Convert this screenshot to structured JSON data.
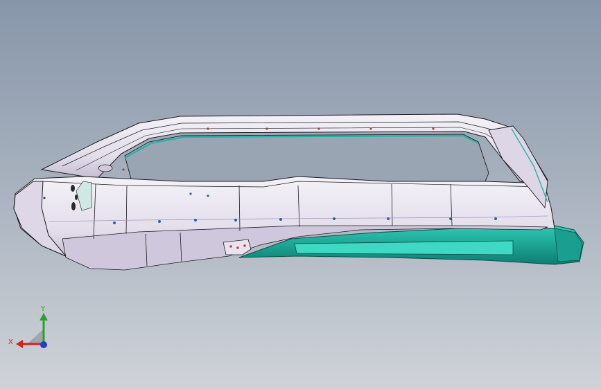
{
  "viewport": {
    "background_top": "#8796aa",
    "background_bottom": "#cfd3d8"
  },
  "model": {
    "body_color": "#ece8f2",
    "shade_color": "#c5bfd4",
    "edge_color": "#1b1b1b",
    "accent_color": "#1fb5a4",
    "detail_color": "#c0392b"
  },
  "triad": {
    "x_label": "X",
    "y_label": "Y",
    "x_color": "#d32020",
    "y_color": "#2ca02c",
    "z_color": "#1f3fd1"
  }
}
